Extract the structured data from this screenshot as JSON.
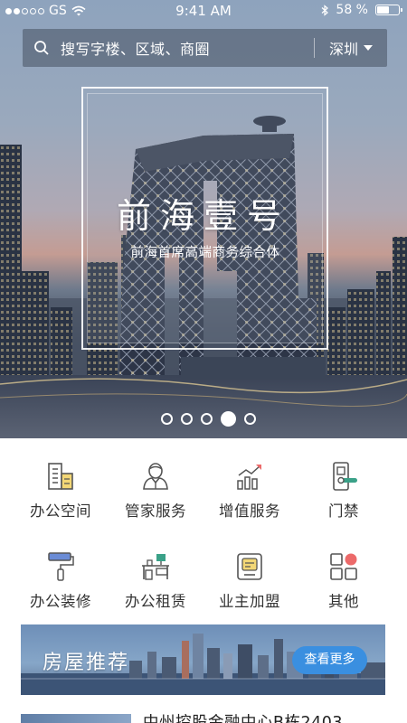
{
  "status_bar": {
    "carrier": "GS",
    "time": "9:41 AM",
    "battery_text": "58 %",
    "battery_level": 0.58,
    "signal_bars_filled": 2
  },
  "search": {
    "placeholder": "搜写字楼、区域、商圈",
    "city": "深圳"
  },
  "banner": {
    "title": "前海壹号",
    "subtitle": "前海首席高端商务综合体",
    "page_count": 5,
    "active_page": 3
  },
  "services": [
    {
      "label": "办公空间",
      "icon": "office-building-icon"
    },
    {
      "label": "管家服务",
      "icon": "butler-icon"
    },
    {
      "label": "增值服务",
      "icon": "growth-chart-icon"
    },
    {
      "label": "门禁",
      "icon": "door-access-icon"
    },
    {
      "label": "办公装修",
      "icon": "paint-roller-icon"
    },
    {
      "label": "办公租赁",
      "icon": "desk-icon"
    },
    {
      "label": "业主加盟",
      "icon": "owner-join-icon"
    },
    {
      "label": "其他",
      "icon": "more-grid-icon"
    }
  ],
  "recommend": {
    "title": "房屋推荐",
    "more_label": "查看更多"
  },
  "listing": {
    "name": "中州控股金融中心B栋2403"
  },
  "colors": {
    "accent_blue": "#3a8fe0",
    "icon_teal": "#3aa188",
    "icon_yellow": "#f3d776",
    "icon_red": "#ec6a6a",
    "text": "#333333"
  }
}
